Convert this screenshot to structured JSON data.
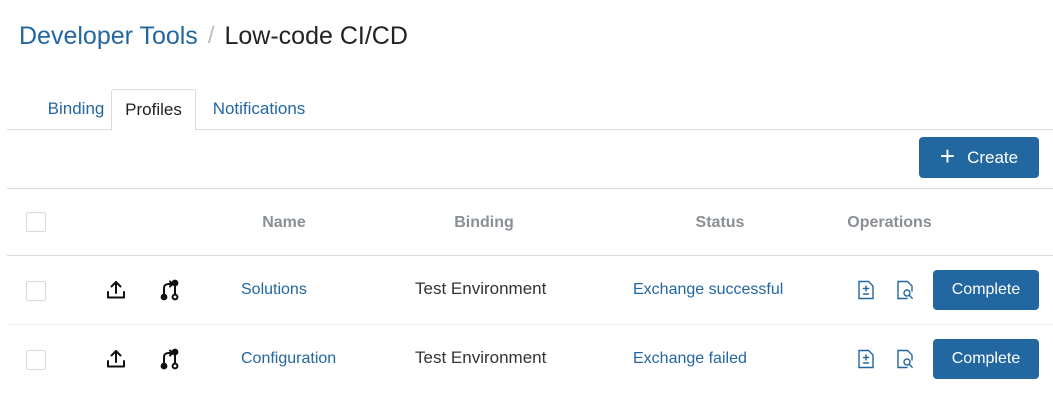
{
  "breadcrumb": {
    "parent": "Developer Tools",
    "separator": "/",
    "current": "Low-code CI/CD"
  },
  "tabs": [
    {
      "label": "Binding",
      "active": false
    },
    {
      "label": "Profiles",
      "active": true
    },
    {
      "label": "Notifications",
      "active": false
    }
  ],
  "toolbar": {
    "create_label": "Create",
    "create_icon": "plus-icon"
  },
  "table": {
    "columns": [
      "Name",
      "Binding",
      "Status",
      "Operations"
    ],
    "rows": [
      {
        "name": "Solutions",
        "binding": "Test Environment",
        "status": "Exchange successful",
        "action_label": "Complete",
        "icons": [
          "upload-icon",
          "git-branch-icon",
          "document-diff-icon",
          "document-search-icon"
        ]
      },
      {
        "name": "Configuration",
        "binding": "Test Environment",
        "status": "Exchange failed",
        "action_label": "Complete",
        "icons": [
          "upload-icon",
          "git-branch-icon",
          "document-diff-icon",
          "document-search-icon"
        ]
      }
    ]
  },
  "colors": {
    "accent": "#2367a1",
    "header_text": "#8a8f95",
    "border": "#d9dde1"
  }
}
